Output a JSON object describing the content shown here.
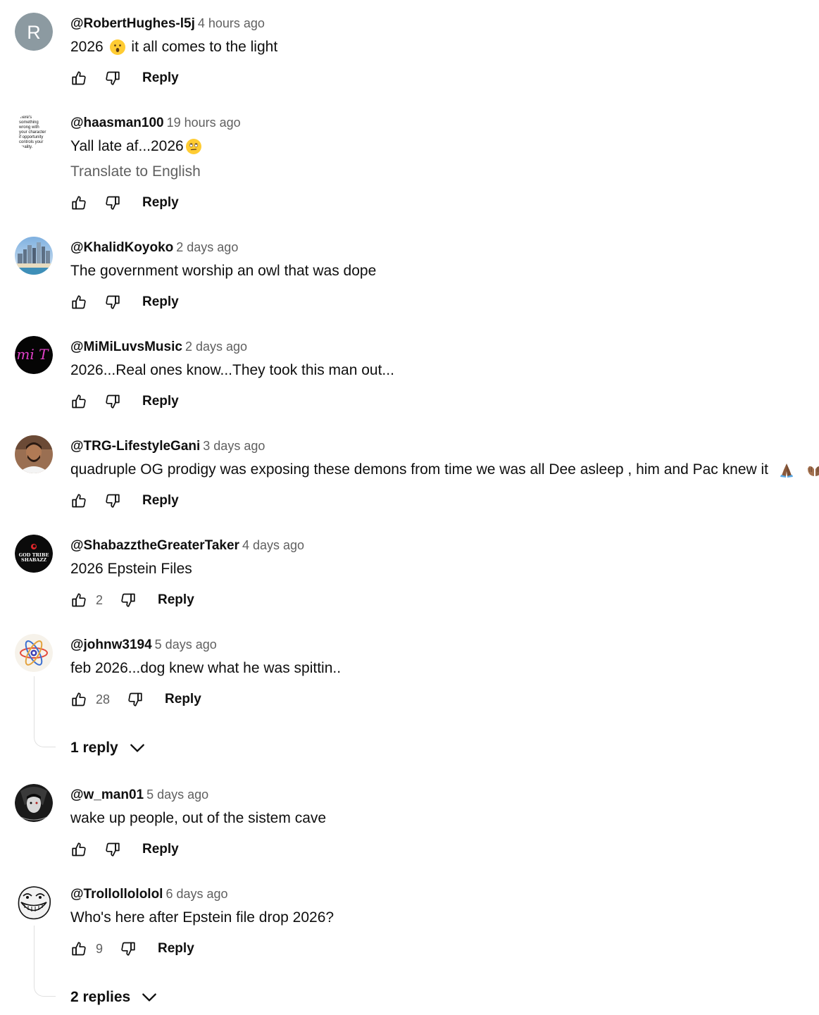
{
  "comments": [
    {
      "author": "@RobertHughes-l5j",
      "time": "4 hours ago",
      "text_before": "2026",
      "emoji": "surprised-face-emoji",
      "text_after": " it all comes to the light",
      "likes": "",
      "reply_label": "Reply",
      "avatar": {
        "type": "letter",
        "letter": "R",
        "color": "#8c9aa1"
      }
    },
    {
      "author": "@haasman100",
      "time": "19 hours ago",
      "text": "Yall late af...2026",
      "emoji": "eye-roll-emoji",
      "translate_label": "Translate to English",
      "likes": "",
      "reply_label": "Reply",
      "avatar": {
        "type": "text-image",
        "lines": [
          "here's",
          "something",
          "wrong with",
          "your character",
          "if opportunity",
          "controls your",
          "reality."
        ]
      }
    },
    {
      "author": "@KhalidKoyoko",
      "time": "2 days ago",
      "text": "The government worship an owl that was dope",
      "likes": "",
      "reply_label": "Reply",
      "avatar": {
        "type": "city-skyline"
      }
    },
    {
      "author": "@MiMiLuvsMusic",
      "time": "2 days ago",
      "text": "2026...Real ones know...They took this man out...",
      "likes": "",
      "reply_label": "Reply",
      "avatar": {
        "type": "neon-logo",
        "letters": "imi T"
      }
    },
    {
      "author": "@TRG-LifestyleGani",
      "time": "3 days ago",
      "text": "quadruple OG prodigy was exposing these demons from time we was all Dee asleep , him and Pac knew it",
      "emojis": [
        "praying-hands-emoji",
        "palms-up-emoji"
      ],
      "likes": "",
      "reply_label": "Reply",
      "avatar": {
        "type": "person-photo"
      }
    },
    {
      "author": "@ShabazztheGreaterTaker",
      "time": "4 days ago",
      "text": "2026 Epstein Files",
      "likes": "2",
      "reply_label": "Reply",
      "avatar": {
        "type": "badge",
        "lines": [
          "GOD TRIBE",
          "SHABAZZ"
        ]
      }
    },
    {
      "author": "@johnw3194",
      "time": "5 days ago",
      "text": "feb 2026...dog knew what he was spittin..",
      "likes": "28",
      "reply_label": "Reply",
      "replies_label": "1 reply",
      "avatar": {
        "type": "atom"
      }
    },
    {
      "author": "@w_man01",
      "time": "5 days ago",
      "text": "wake up people, out of the sistem cave",
      "likes": "",
      "reply_label": "Reply",
      "avatar": {
        "type": "dark-art"
      }
    },
    {
      "author": "@Trollollololol",
      "time": "6 days ago",
      "text": "Who's here after Epstein file drop 2026?",
      "likes": "9",
      "reply_label": "Reply",
      "replies_label": "2 replies",
      "avatar": {
        "type": "troll-face"
      }
    }
  ]
}
